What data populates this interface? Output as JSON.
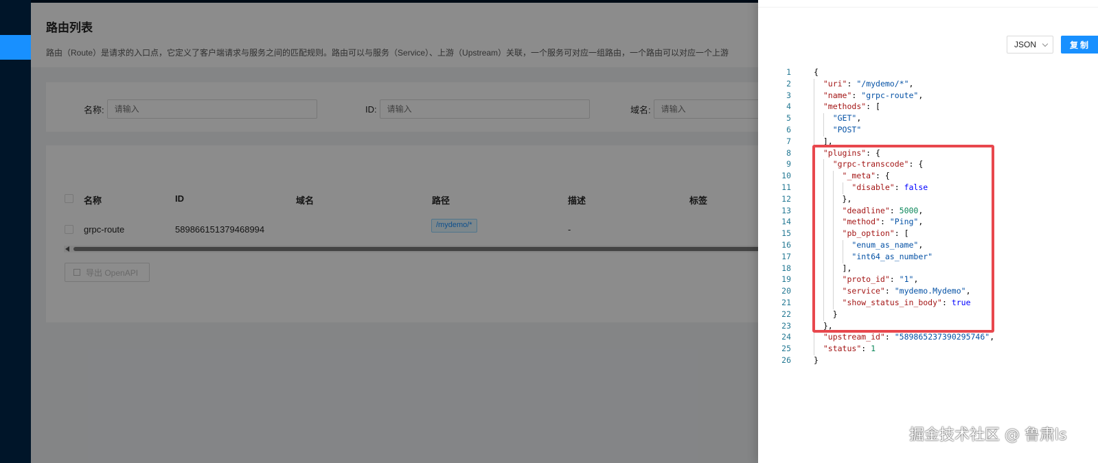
{
  "page": {
    "title": "路由列表",
    "description": "路由（Route）是请求的入口点，它定义了客户端请求与服务之间的匹配规则。路由可以与服务（Service）、上游（Upstream）关联，一个服务可对应一组路由，一个路由可以对应一个上游"
  },
  "search": {
    "name_label": "名称:",
    "name_placeholder": "请输入",
    "id_label": "ID:",
    "id_placeholder": "请输入",
    "host_label": "域名:",
    "host_placeholder": "请输入"
  },
  "table": {
    "columns": [
      "名称",
      "ID",
      "域名",
      "路径",
      "描述",
      "标签"
    ],
    "rows": [
      {
        "name": "grpc-route",
        "id": "589866151379468994",
        "host": "",
        "path": "/mydemo/*",
        "desc": "-",
        "labels": ""
      }
    ],
    "export_label": "导出 OpenAPI"
  },
  "drawer": {
    "format": "JSON",
    "copy_label": "复制",
    "lines": [
      "{",
      "  \"uri\": \"/mydemo/*\",",
      "  \"name\": \"grpc-route\",",
      "  \"methods\": [",
      "    \"GET\",",
      "    \"POST\"",
      "  ],",
      "  \"plugins\": {",
      "    \"grpc-transcode\": {",
      "      \"_meta\": {",
      "        \"disable\": false",
      "      },",
      "      \"deadline\": 5000,",
      "      \"method\": \"Ping\",",
      "      \"pb_option\": [",
      "        \"enum_as_name\",",
      "        \"int64_as_number\"",
      "      ],",
      "      \"proto_id\": \"1\",",
      "      \"service\": \"mydemo.Mydemo\",",
      "      \"show_status_in_body\": true",
      "    }",
      "  },",
      "  \"upstream_id\": \"589865237390295746\",",
      "  \"status\": 1",
      "}"
    ]
  },
  "watermark": "掘金技术社区 @ 鲁肃ls",
  "colors": {
    "primary": "#1890ff",
    "highlight": "#e8474d",
    "sidebar": "#001529"
  }
}
